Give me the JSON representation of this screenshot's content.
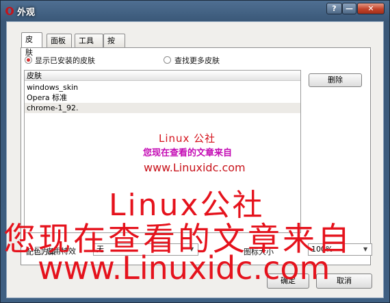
{
  "window": {
    "title": "外观",
    "help_label": "?",
    "minimize_label": "—",
    "close_label": "✕"
  },
  "tabs": [
    {
      "label": "皮肤"
    },
    {
      "label": "面板"
    },
    {
      "label": "工具栏"
    },
    {
      "label": "按钮"
    }
  ],
  "skin_source": {
    "installed_label": "显示已安装的皮肤",
    "installed_selected": true,
    "more_label": "查找更多皮肤"
  },
  "skin_list": {
    "header": "皮肤",
    "rows": [
      "windows_skin",
      "Opera 标准",
      "chrome-1_92."
    ]
  },
  "delete_label": "删除",
  "options": {
    "special_effects_label": "启用特效",
    "color_scheme_label": "配色方案",
    "color_scheme_value": "无",
    "icon_size_label": "图标大小",
    "icon_size_value": "100%"
  },
  "footer": {
    "ok_label": "确定",
    "cancel_label": "取消"
  },
  "watermark": {
    "small_line1": "Linux 公社",
    "small_line2": "您现在查看的文章来自",
    "small_line3": "www.Linuxidc.com",
    "large_line1": "Linux公社",
    "large_line2": "您现在查看的文章来自",
    "large_line3": "www.Linuxidc.com"
  },
  "colors": {
    "accent_red": "#e5121c",
    "accent_magenta": "#c40bb4",
    "title_bar": "#3a5878"
  }
}
